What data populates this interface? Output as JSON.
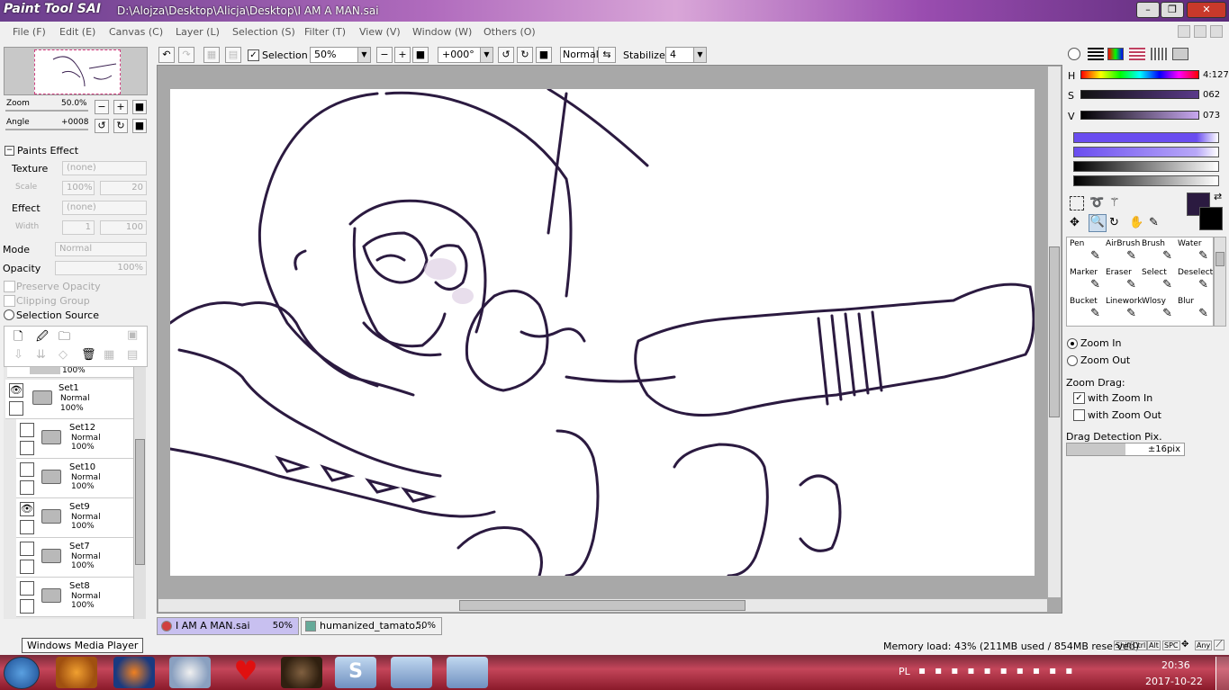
{
  "window": {
    "app_logo": "Paint Tool SAI",
    "path": "D:\\Alojza\\Desktop\\Alicja\\Desktop\\I AM A MAN.sai",
    "buttons": [
      "–",
      "❐",
      "✕"
    ]
  },
  "menu": [
    "File (F)",
    "Edit (E)",
    "Canvas (C)",
    "Layer (L)",
    "Selection (S)",
    "Filter (T)",
    "View (V)",
    "Window (W)",
    "Others (O)"
  ],
  "toolbar": {
    "selection_label": "Selection",
    "zoom_value": "50%",
    "angle_value": "+000°",
    "blend_mode": "Normal",
    "stabilizer_label": "Stabilizer",
    "stabilizer_value": "4"
  },
  "navigator": {
    "zoom_label": "Zoom",
    "zoom_value": "50.0%",
    "angle_label": "Angle",
    "angle_value": "+0008"
  },
  "paints_effect": {
    "header": "Paints Effect",
    "texture_label": "Texture",
    "texture_value": "(none)",
    "scale_label": "Scale",
    "scale_value": "100%",
    "scale_num": "20",
    "effect_label": "Effect",
    "effect_value": "(none)",
    "width_label": "Width",
    "width_value": "1",
    "width_num": "100"
  },
  "layer_props": {
    "mode_label": "Mode",
    "mode_value": "Normal",
    "opacity_label": "Opacity",
    "opacity_value": "100%",
    "preserve_opacity": "Preserve Opacity",
    "clipping_group": "Clipping Group",
    "selection_source": "Selection Source"
  },
  "layers": [
    {
      "name": "Set1",
      "mode": "Normal",
      "opacity": "100%",
      "visible": true
    },
    {
      "name": "Set12",
      "mode": "Normal",
      "opacity": "100%",
      "visible": false
    },
    {
      "name": "Set10",
      "mode": "Normal",
      "opacity": "100%",
      "visible": false
    },
    {
      "name": "Set9",
      "mode": "Normal",
      "opacity": "100%",
      "visible": true
    },
    {
      "name": "Set7",
      "mode": "Normal",
      "opacity": "100%",
      "visible": false
    },
    {
      "name": "Set8",
      "mode": "Normal",
      "opacity": "100%",
      "visible": false
    }
  ],
  "layer_top_partial_opacity": "100%",
  "color": {
    "h_label": "H",
    "h_value": "4:127",
    "s_label": "S",
    "s_value": "062",
    "v_label": "V",
    "v_value": "073",
    "fg": "#2b1a40",
    "bg": "#000000",
    "accent": "#6a4df0"
  },
  "tools": [
    {
      "label": "Pen",
      "icon": "pen-icon"
    },
    {
      "label": "AirBrush",
      "icon": "airbrush-icon"
    },
    {
      "label": "Brush",
      "icon": "brush-icon"
    },
    {
      "label": "Water",
      "icon": "water-icon"
    },
    {
      "label": "Marker",
      "icon": "marker-icon"
    },
    {
      "label": "Eraser",
      "icon": "eraser-icon"
    },
    {
      "label": "Select",
      "icon": "select-icon"
    },
    {
      "label": "Deselect",
      "icon": "deselect-icon"
    },
    {
      "label": "Bucket",
      "icon": "bucket-icon"
    },
    {
      "label": "Linework",
      "icon": "linework-icon"
    },
    {
      "label": "Wlosy",
      "icon": "wlosy-icon"
    },
    {
      "label": "Blur",
      "icon": "blur-icon"
    }
  ],
  "zoom_options": {
    "zoom_in": "Zoom In",
    "zoom_out": "Zoom Out",
    "drag_label": "Zoom Drag:",
    "with_zoom_in": "with Zoom In",
    "with_zoom_out": "with Zoom Out",
    "detection_label": "Drag Detection Pix.",
    "detection_value": "±16pix"
  },
  "doc_tabs": [
    {
      "name": "I AM A MAN.sai",
      "zoom": "50%",
      "active": true
    },
    {
      "name": "humanized_tamato...",
      "zoom": "50%",
      "active": false
    }
  ],
  "status": {
    "tooltip": "Windows Media Player",
    "memory": "Memory load: 43% (211MB used / 854MB reserved)",
    "keys": [
      "Shift",
      "Ctrl",
      "Alt",
      "SPC",
      "Any"
    ]
  },
  "taskbar": {
    "lang": "PL",
    "time": "20:36",
    "date": "2017-10-22"
  }
}
